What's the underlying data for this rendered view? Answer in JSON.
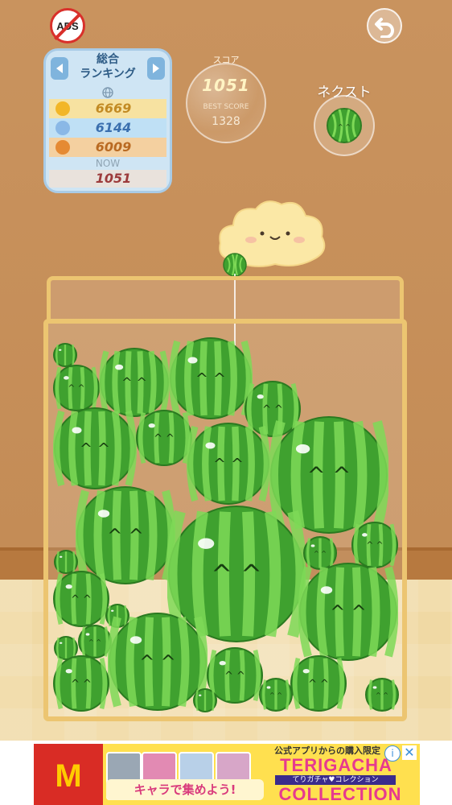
{
  "top_bar": {
    "ads_label": "ADS"
  },
  "ranking": {
    "title_line1": "総合",
    "title_line2": "ランキング",
    "entries": [
      {
        "rank": 1,
        "score": "6669"
      },
      {
        "rank": 2,
        "score": "6144"
      },
      {
        "rank": 3,
        "score": "6009"
      }
    ],
    "now_label": "NOW",
    "now_score": "1051"
  },
  "score": {
    "label": "スコア",
    "value": "1051",
    "best_label": "BEST SCORE",
    "best_value": "1328"
  },
  "next": {
    "label": "ネクスト",
    "fruit": "watermelon"
  },
  "board": {
    "held_fruit": "watermelon-small",
    "fruits_in_box": 31
  },
  "ad": {
    "brand_logo": "mcdonalds-logo",
    "caption": "キャラで集めよう!",
    "small_text": "公式アプリからの購入限定",
    "brand_line1": "TERIGACHA",
    "tagline": "てりガチャ♥コレクション",
    "brand_line2": "COLLECTION",
    "info_glyph": "i",
    "close_glyph": "✕"
  },
  "colors": {
    "wall": "#c9935e",
    "box_frame": "#ecc571",
    "watermelon_dark": "#2f8a26",
    "watermelon_light": "#7ed957"
  }
}
